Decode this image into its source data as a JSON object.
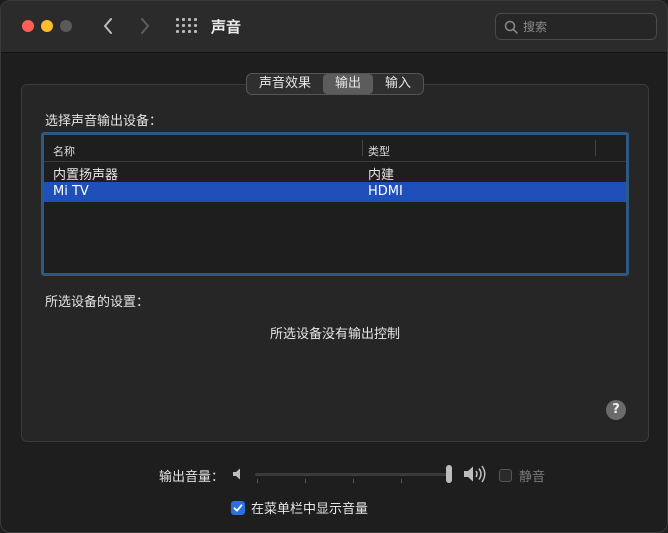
{
  "window": {
    "title": "声音"
  },
  "search": {
    "placeholder": "搜索"
  },
  "tabs": [
    {
      "label": "声音效果",
      "active": false
    },
    {
      "label": "输出",
      "active": true
    },
    {
      "label": "输入",
      "active": false
    }
  ],
  "output": {
    "select_label": "选择声音输出设备：",
    "columns": {
      "name": "名称",
      "type": "类型"
    },
    "devices": [
      {
        "name": "内置扬声器",
        "type": "内建",
        "selected": false
      },
      {
        "name": "Mi TV",
        "type": "HDMI",
        "selected": true
      }
    ],
    "settings_label": "所选设备的设置：",
    "no_control_text": "所选设备没有输出控制",
    "help": "?"
  },
  "volume": {
    "label": "输出音量：",
    "level": 1.0,
    "mute_label": "静音",
    "muted": false
  },
  "menubar_option": {
    "label": "在菜单栏中显示音量",
    "checked": true
  },
  "colors": {
    "selection": "#1f4fb8",
    "focus_ring": "#2e5a82",
    "checkbox": "#2b6fe0"
  }
}
